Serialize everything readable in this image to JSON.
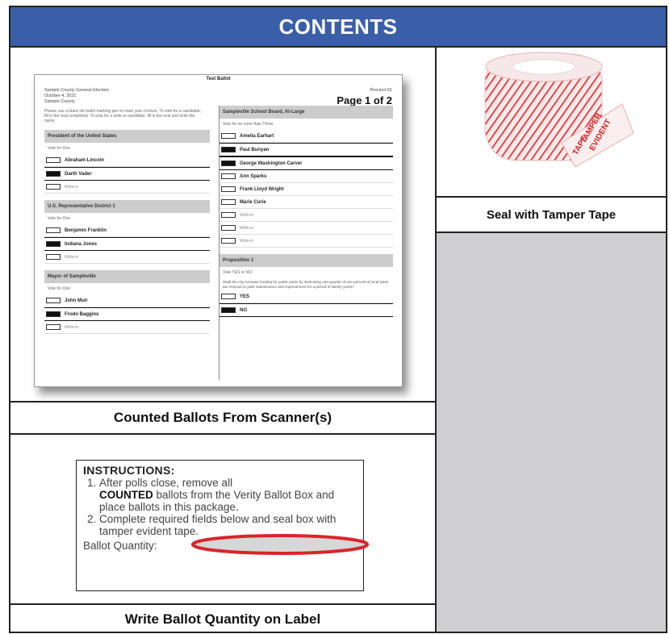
{
  "header": {
    "title": "CONTENTS"
  },
  "ballot": {
    "title": "Test Ballot",
    "county_lines": [
      "Sample County General Election",
      "October 4, 2021",
      "Sample County"
    ],
    "precinct": "Precinct 01",
    "page_label": "Page 1 of 2",
    "instructions": "Please use a black ink ballot marking pen to mark your choices. To vote for a candidate, fill in the oval completely. To vote for a write-in candidate, fill in the oval and write the name.",
    "left_sections": [
      {
        "heading": "President of the United States",
        "sub": "Vote for One",
        "options": [
          {
            "label": "Abraham Lincoln",
            "filled": false,
            "writein": false
          },
          {
            "label": "Darth Vader",
            "filled": true,
            "writein": false
          },
          {
            "label": "Write-in",
            "filled": false,
            "writein": true
          }
        ]
      },
      {
        "heading": "U.S. Representative District 1",
        "sub": "Vote for One",
        "options": [
          {
            "label": "Benjamin Franklin",
            "filled": false,
            "writein": false
          },
          {
            "label": "Indiana Jones",
            "filled": true,
            "writein": false
          },
          {
            "label": "Write-in",
            "filled": false,
            "writein": true
          }
        ]
      },
      {
        "heading": "Mayor of Sampleville",
        "sub": "Vote for One",
        "options": [
          {
            "label": "John Muir",
            "filled": false,
            "writein": false
          },
          {
            "label": "Frodo Baggins",
            "filled": true,
            "writein": false
          },
          {
            "label": "Write-in",
            "filled": false,
            "writein": true
          }
        ]
      }
    ],
    "right_sections": [
      {
        "heading": "Sampleville School Board, At-Large",
        "sub": "Vote for no more than Three",
        "options": [
          {
            "label": "Amelia Earhart",
            "filled": false,
            "writein": false
          },
          {
            "label": "Paul Bunyan",
            "filled": true,
            "writein": false
          },
          {
            "label": "George Washington Carver",
            "filled": true,
            "writein": false
          },
          {
            "label": "Ann Sparks",
            "filled": false,
            "writein": false
          },
          {
            "label": "Frank Lloyd Wright",
            "filled": false,
            "writein": false
          },
          {
            "label": "Marie Curie",
            "filled": false,
            "writein": false
          },
          {
            "label": "Write-in",
            "filled": false,
            "writein": true
          },
          {
            "label": "Write-in",
            "filled": false,
            "writein": true
          },
          {
            "label": "Write-in",
            "filled": false,
            "writein": true
          }
        ]
      },
      {
        "heading": "Proposition 1",
        "sub": "Vote YES or NO",
        "text": "Shall the city increase funding for public parks by dedicating one-quarter of one percent of local sales tax revenue to park maintenance and improvement for a period of twenty years?",
        "options": [
          {
            "label": "YES",
            "filled": false,
            "writein": false
          },
          {
            "label": "NO",
            "filled": true,
            "writein": false
          }
        ]
      }
    ]
  },
  "captions": {
    "ballots": "Counted Ballots From Scanner(s)",
    "ballot_quantity": "Write Ballot Quantity on Label",
    "tamper_tape": "Seal with Tamper Tape"
  },
  "tape": {
    "text_line1": "TAMPER",
    "text_line2": "EVIDENT",
    "text_line3": "TAPE"
  },
  "instructions_label": {
    "title": "INSTRUCTIONS:",
    "step1_pre": "After polls close, remove all",
    "step1_bold": "COUNTED",
    "step1_post": "ballots from the Verity Ballot Box and place ballots in this package.",
    "step2": "Complete required fields below and seal box with tamper evident tape.",
    "quantity_label": "Ballot Quantity:"
  },
  "colors": {
    "header": "#3a5ea8",
    "tape_red": "#d9252a",
    "gray_panel": "#cfcfd1"
  }
}
